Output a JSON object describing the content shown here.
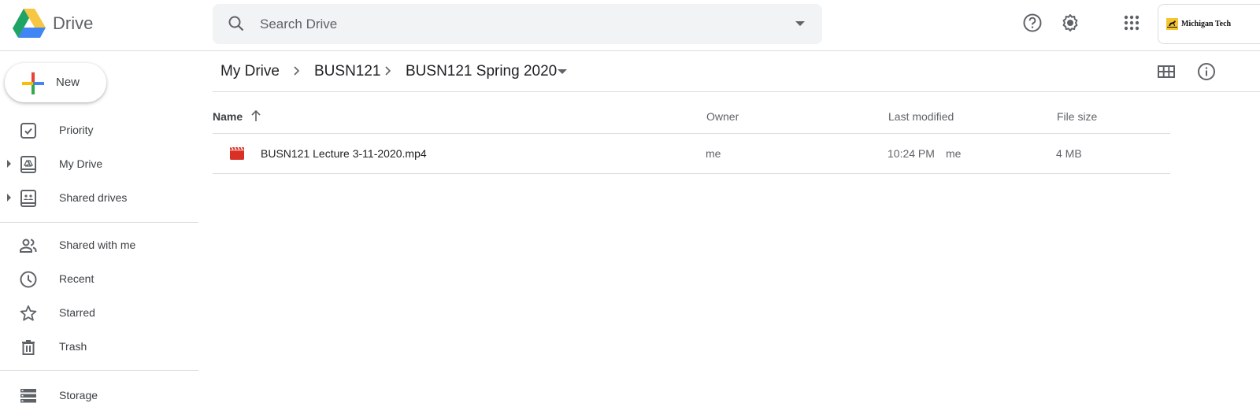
{
  "app": {
    "name": "Drive",
    "brand_colors": {
      "green": "#0f9d58",
      "yellow": "#f4b400",
      "blue": "#4285f4",
      "red": "#db4437"
    }
  },
  "header": {
    "search": {
      "placeholder": "Search Drive",
      "icon": "search-icon",
      "options_icon": "dropdown-caret-icon"
    },
    "icons": [
      "help-icon",
      "settings-icon",
      "apps-grid-icon"
    ],
    "account": {
      "label": "Michigan Tech",
      "icon": "michigan-tech-logo"
    }
  },
  "sidebar": {
    "new_button": {
      "label": "New",
      "icon": "plus-icon"
    },
    "items": [
      {
        "label": "Priority",
        "icon": "priority-check-icon",
        "expandable": false
      },
      {
        "label": "My Drive",
        "icon": "my-drive-icon",
        "expandable": true
      },
      {
        "label": "Shared drives",
        "icon": "shared-drives-icon",
        "expandable": true
      },
      {
        "label": "Shared with me",
        "icon": "people-icon",
        "expandable": false
      },
      {
        "label": "Recent",
        "icon": "clock-icon",
        "expandable": false
      },
      {
        "label": "Starred",
        "icon": "star-icon",
        "expandable": false
      },
      {
        "label": "Trash",
        "icon": "trash-icon",
        "expandable": false
      },
      {
        "label": "Storage",
        "icon": "storage-icon",
        "expandable": false
      }
    ]
  },
  "breadcrumb": {
    "items": [
      "My Drive",
      "BUSN121",
      "BUSN121 Spring 2020"
    ],
    "separator_icon": "chevron-right-icon",
    "current_menu_icon": "dropdown-caret-icon"
  },
  "toolbar": {
    "icons": [
      "grid-view-icon",
      "info-icon"
    ]
  },
  "file_list": {
    "columns": [
      "Name",
      "Owner",
      "Last modified",
      "File size"
    ],
    "sort": {
      "column": "Name",
      "direction": "ascending",
      "icon": "arrow-up-icon"
    },
    "rows": [
      {
        "name": "BUSN121 Lecture 3-11-2020.mp4",
        "type_icon": "video-file-icon",
        "owner": "me",
        "last_modified": "10:24 PM",
        "modified_by": "me",
        "file_size": "4 MB"
      }
    ]
  }
}
